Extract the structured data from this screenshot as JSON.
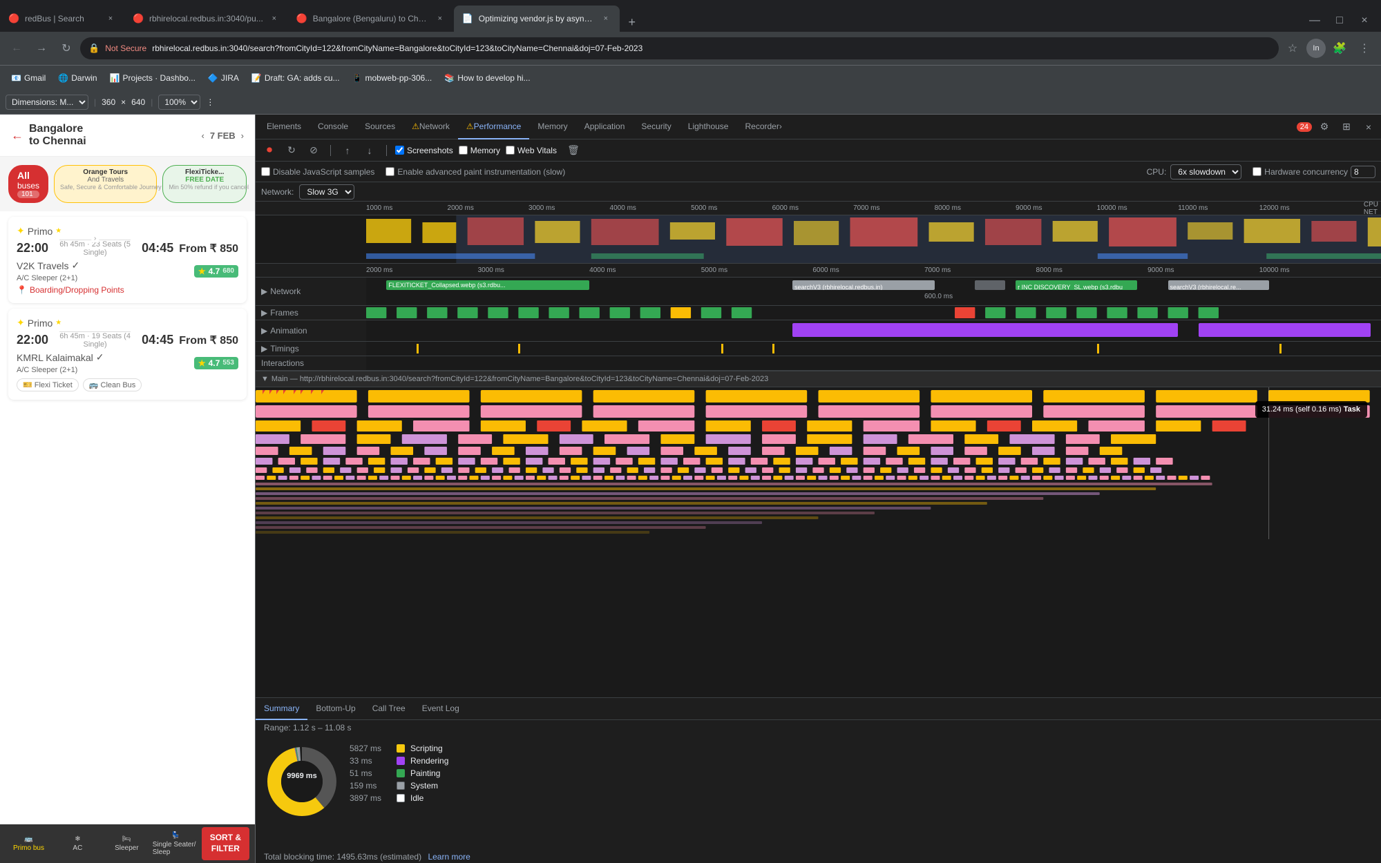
{
  "browser": {
    "tabs": [
      {
        "id": "tab1",
        "title": "redBus | Search",
        "favicon": "🔴",
        "active": false,
        "url": "redbus.in"
      },
      {
        "id": "tab2",
        "title": "rbhirelocal.redbus.in:3040/pu...",
        "favicon": "🔴",
        "active": false,
        "url": "rbhirelocal"
      },
      {
        "id": "tab3",
        "title": "Bangalore (Bengaluru) to Che...",
        "favicon": "🔴",
        "active": false,
        "url": "bangalore"
      },
      {
        "id": "tab4",
        "title": "Optimizing vendor.js by async...",
        "favicon": "📄",
        "active": true,
        "url": "optimizing"
      }
    ],
    "address": {
      "not_secure": "Not Secure",
      "url": "rbhirelocal.redbus.in:3040/search?fromCityId=122&fromCityName=Bangalore&toCityId=123&toCityName=Chennai&doj=07-Feb-2023"
    },
    "bookmarks": [
      "Gmail",
      "Darwin",
      "Projects · Dashbo...",
      "JIRA",
      "Draft: GA: adds cu...",
      "mobweb-pp-306...",
      "How to develop hi..."
    ]
  },
  "devtools": {
    "dimensions_label": "Dimensions: M...",
    "width": "360",
    "height": "640",
    "zoom": "100%",
    "tabs": [
      "Elements",
      "Console",
      "Sources",
      "Network",
      "Performance",
      "Memory",
      "Application",
      "Security",
      "Lighthouse",
      "Recorder"
    ],
    "active_tab": "Performance",
    "toolbar": {
      "record_label": "Record",
      "reload_label": "Reload",
      "clear_label": "Clear",
      "load_profile_label": "Load profile",
      "save_profile_label": "Save profile",
      "screenshots_label": "Screenshots",
      "screenshots_checked": true,
      "memory_label": "Memory",
      "memory_checked": false,
      "webvitals_label": "Web Vitals",
      "webvitals_checked": false
    },
    "options": {
      "disable_js_samples": "Disable JavaScript samples",
      "disable_js_samples_checked": false,
      "enable_advanced_paint": "Enable advanced paint instrumentation (slow)",
      "enable_advanced_paint_checked": false,
      "cpu_label": "CPU:",
      "cpu_value": "6x slowdown",
      "hardware_concurrency_label": "Hardware concurrency",
      "hardware_concurrency_checked": false,
      "hardware_concurrency_value": "8",
      "network_label": "Network:",
      "network_value": "Slow 3G"
    },
    "timeline": {
      "ruler_ticks": [
        "1000 ms",
        "2000 ms",
        "3000 ms",
        "4000 ms",
        "5000 ms",
        "6000 ms",
        "7000 ms",
        "8000 ms",
        "9000 ms",
        "10000 ms",
        "11000 ms",
        "12000 ms"
      ],
      "tracks": [
        {
          "name": "Network",
          "expanded": false,
          "has_triangle": true
        },
        {
          "name": "Frames",
          "expanded": false,
          "has_triangle": true
        },
        {
          "name": "Animation",
          "expanded": false,
          "has_triangle": true
        },
        {
          "name": "Timings",
          "expanded": false,
          "has_triangle": true
        },
        {
          "name": "Interactions",
          "expanded": false,
          "has_triangle": false
        }
      ],
      "network_items": [
        {
          "label": "FLEXITICKET_Collapsed.webp (s3.rdbu...",
          "color": "green"
        },
        {
          "label": "searchV3 (rbhirelocal.redbus.in)",
          "color": "gray"
        },
        {
          "label": "r INC DISCOVERY_SL.webp (s3.rdbu",
          "color": "green"
        },
        {
          "label": "searchV3 (rbhirelocal.re...",
          "color": "gray"
        }
      ],
      "flame_url": "Main — http://rbhirelocal.redbus.in:3040/search?fromCityId=122&fromCityName=Bangalore&toCityId=123&toCityName=Chennai&doj=07-Feb-2023",
      "tooltip": {
        "time": "31.24 ms (self 0.16 ms)",
        "type": "Task"
      }
    },
    "summary": {
      "tabs": [
        "Summary",
        "Bottom-Up",
        "Call Tree",
        "Event Log"
      ],
      "active_tab": "Summary",
      "range": "Range: 1.12 s – 11.08 s",
      "items": [
        {
          "value": "5827 ms",
          "label": "Scripting",
          "color": "#f6c90e"
        },
        {
          "value": "33 ms",
          "label": "Rendering",
          "color": "#a142f4"
        },
        {
          "value": "51 ms",
          "label": "Painting",
          "color": "#34a853"
        },
        {
          "value": "159 ms",
          "label": "System",
          "color": "#9aa0a6"
        },
        {
          "value": "3897 ms",
          "label": "Idle",
          "color": "#e8eaed"
        }
      ],
      "donut_center": "9969 ms",
      "total_blocking": "Total blocking time: 1495.63ms (estimated)",
      "learn_more": "Learn more"
    }
  },
  "webpage": {
    "route": "Bangalore\nto Chennai",
    "date": "7 FEB",
    "filter_chips": [
      {
        "label": "All buses\n101",
        "active": true
      },
      {
        "label": "Orange Tours\nAnd Travels",
        "active": false
      },
      {
        "label": "FlexiTicke...\nFREE DATE\nMin 50% refund...",
        "active": false
      }
    ],
    "buses": [
      {
        "operator": "Primo",
        "dep_time": "22:00",
        "arr_time": "04:45",
        "duration": "6h 45m · 23 Seats (5 Single)",
        "price": "₹ 850",
        "price_label": "From",
        "operator2": "V2K Travels",
        "rating": "4.7",
        "rating_count": "680",
        "bus_type": "A/C Sleeper (2+1)",
        "boarding": "Boarding/Dropping Points"
      },
      {
        "operator": "Primo",
        "dep_time": "22:00",
        "arr_time": "04:45",
        "duration": "6h 45m · 19 Seats (4 Single)",
        "price": "₹ 850",
        "price_label": "From",
        "operator2": "KMRL Kalaimakal",
        "rating": "4.7",
        "rating_count": "553",
        "bus_type": "A/C Sleeper (2+1)",
        "tags": [
          "Flexi Ticket",
          "Clean Bus"
        ]
      }
    ],
    "bottom_bar": {
      "items": [
        "Primo bus",
        "AC",
        "Sleeper",
        "Single Seater/ Sleep"
      ],
      "sort_filter": "SORT &\nFILTER"
    }
  },
  "icons": {
    "record": "⏺",
    "reload": "↻",
    "clear": "⊘",
    "import": "↑",
    "export": "↓",
    "back": "←",
    "forward": "→",
    "close": "×",
    "triangle_right": "▶",
    "triangle_down": "▼",
    "star": "★",
    "location": "📍",
    "arrow_back": "←",
    "chevron_left": "‹",
    "chevron_right": "›",
    "lock": "🔒",
    "warning": "⚠",
    "settings": "⚙",
    "more": "⋮",
    "home": "🏠",
    "ac": "❄",
    "sleeper": "🛏",
    "seat": "💺",
    "star_small": "⭐",
    "bus": "🚌",
    "primo_star": "✦"
  },
  "colors": {
    "accent_red": "#d63031",
    "devtools_bg": "#1e1e1e",
    "devtools_active": "#8ab4f8",
    "scripting_color": "#f6c90e",
    "rendering_color": "#a142f4",
    "painting_color": "#34a853",
    "system_color": "#9aa0a6",
    "idle_color": "#e8eaed"
  }
}
